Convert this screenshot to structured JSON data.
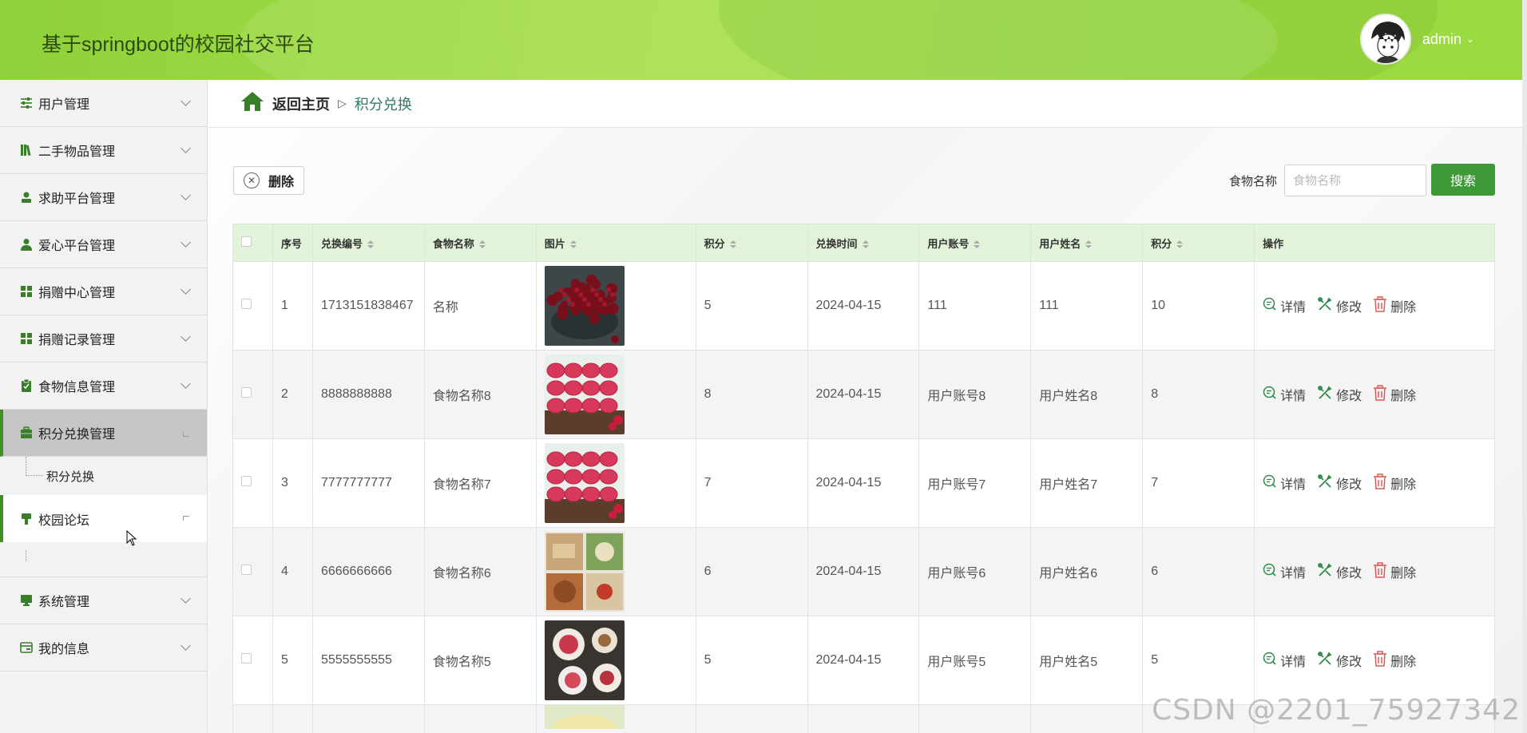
{
  "app": {
    "title": "基于springboot的校园社交平台",
    "username": "admin"
  },
  "colors": {
    "accent": "#3d9a36",
    "header": "#a6df47"
  },
  "sidebar": {
    "items": [
      {
        "label": "用户管理",
        "icon": "sliders-icon"
      },
      {
        "label": "二手物品管理",
        "icon": "books-icon"
      },
      {
        "label": "求助平台管理",
        "icon": "person-icon"
      },
      {
        "label": "爱心平台管理",
        "icon": "user-icon"
      },
      {
        "label": "捐赠中心管理",
        "icon": "grid-icon"
      },
      {
        "label": "捐赠记录管理",
        "icon": "grid-icon"
      },
      {
        "label": "食物信息管理",
        "icon": "clipboard-check-icon"
      },
      {
        "label": "积分兑换管理",
        "icon": "briefcase-icon"
      },
      {
        "label": "积分兑换",
        "icon": ""
      },
      {
        "label": "校园论坛",
        "icon": "flag-icon"
      },
      {
        "label": "系统管理",
        "icon": "monitor-icon"
      },
      {
        "label": "我的信息",
        "icon": "card-icon"
      }
    ]
  },
  "breadcrumb": {
    "home": "返回主页",
    "sep": "▷",
    "current": "积分兑换"
  },
  "toolbar": {
    "delete_label": "删除",
    "search_label": "食物名称",
    "search_placeholder": "食物名称",
    "search_button": "搜索"
  },
  "table": {
    "headers": [
      "序号",
      "兑换编号",
      "食物名称",
      "图片",
      "积分",
      "兑换时间",
      "用户账号",
      "用户姓名",
      "积分",
      "操作"
    ],
    "actions": {
      "detail": "详情",
      "edit": "修改",
      "delete": "删除"
    },
    "rows": [
      {
        "no": "1",
        "code": "1713151838467",
        "food": "名称",
        "points": "5",
        "time": "2024-04-15",
        "account": "111",
        "name": "111",
        "score": "10",
        "img": "cherries"
      },
      {
        "no": "2",
        "code": "8888888888",
        "food": "食物名称8",
        "points": "8",
        "time": "2024-04-15",
        "account": "用户账号8",
        "name": "用户姓名8",
        "score": "8",
        "img": "macarons"
      },
      {
        "no": "3",
        "code": "7777777777",
        "food": "食物名称7",
        "points": "7",
        "time": "2024-04-15",
        "account": "用户账号7",
        "name": "用户姓名7",
        "score": "7",
        "img": "macarons"
      },
      {
        "no": "4",
        "code": "6666666666",
        "food": "食物名称6",
        "points": "6",
        "time": "2024-04-15",
        "account": "用户账号6",
        "name": "用户姓名6",
        "score": "6",
        "img": "platter"
      },
      {
        "no": "5",
        "code": "5555555555",
        "food": "食物名称5",
        "points": "5",
        "time": "2024-04-15",
        "account": "用户账号5",
        "name": "用户姓名5",
        "score": "5",
        "img": "platter2"
      }
    ]
  },
  "watermark": "CSDN @2201_75927342"
}
